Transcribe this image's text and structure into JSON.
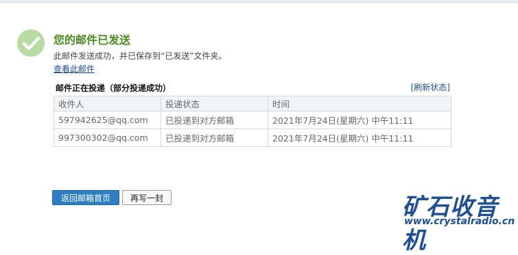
{
  "result": {
    "title": "您的邮件已发送",
    "description": "此邮件发送成功，并已保存到“已发送”文件夹。",
    "view_link": "查看此邮件"
  },
  "delivery": {
    "status_label": "邮件正在投递（部分投递成功）",
    "refresh": "[刷新状态]",
    "columns": [
      "收件人",
      "投递状态",
      "时间"
    ],
    "rows": [
      {
        "recipient": "597942625@qq.com",
        "status": "已投递到对方邮箱",
        "time": "2021年7月24日(星期六) 中午11:11"
      },
      {
        "recipient": "997300302@qq.com",
        "status": "已投递到对方邮箱",
        "time": "2021年7月24日(星期六) 中午11:11"
      }
    ]
  },
  "actions": {
    "back_label": "返回邮箱首页",
    "write_again_label": "再写一封"
  },
  "watermark": {
    "main": "矿石收音机",
    "url": "www.crystalradio.cn"
  },
  "icons": {
    "success": "checkmark-circle-icon"
  },
  "colors": {
    "accent_green": "#4a8b1e",
    "link_blue": "#1a4e96",
    "primary_button": "#2f7fc0"
  }
}
